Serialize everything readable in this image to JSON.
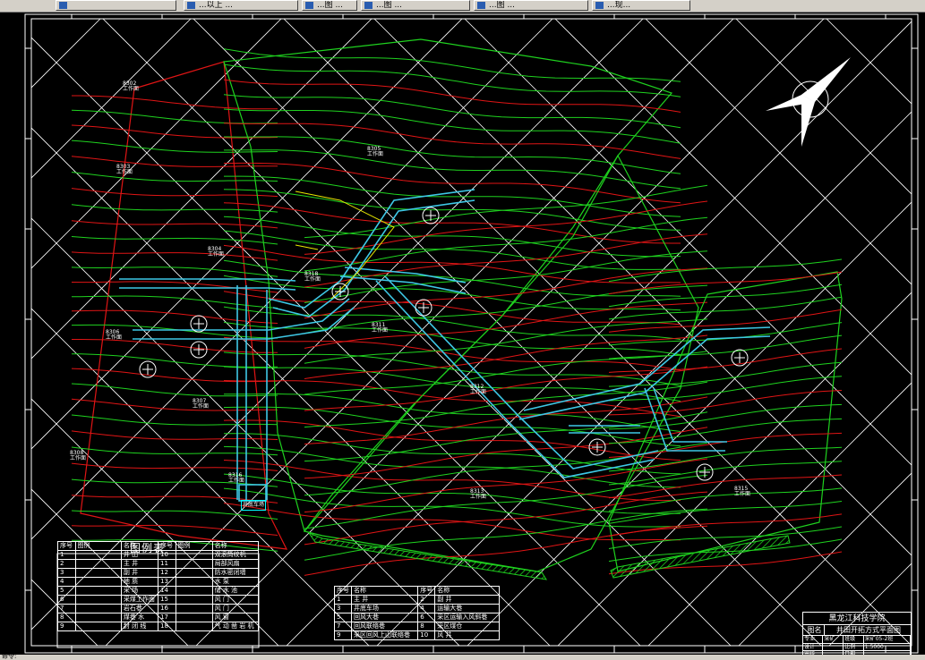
{
  "taskbar": {
    "tabs": [
      {
        "label": ""
      },
      {
        "label": "...以上 ..."
      },
      {
        "label": "...图 ..."
      },
      {
        "label": "...图 ..."
      },
      {
        "label": "...图 ..."
      },
      {
        "label": "...现..."
      }
    ]
  },
  "status": {
    "text": "命令:"
  },
  "legend": {
    "title": "图例表",
    "header": [
      "序号",
      "图例",
      "名称",
      "序号",
      "图例",
      "名称"
    ],
    "rows": [
      [
        "1",
        "",
        "井 田",
        "10",
        "",
        "双滚筒绞机"
      ],
      [
        "2",
        "",
        "主 井",
        "11",
        "",
        "局部风扇"
      ],
      [
        "3",
        "",
        "副 井",
        "12",
        "",
        "防水密闭墙"
      ],
      [
        "4",
        "",
        "地 质",
        "13",
        "",
        "水 泵"
      ],
      [
        "5",
        "",
        "采 场",
        "14",
        "",
        "储 水 池"
      ],
      [
        "6",
        "",
        "采煤工作面",
        "15",
        "",
        "风 门"
      ],
      [
        "7",
        "",
        "岩石巷",
        "16",
        "",
        "风 门"
      ],
      [
        "8",
        "",
        "煤巷 水",
        "17",
        "",
        "风 窗"
      ],
      [
        "9",
        "",
        "封 闭 线",
        "18",
        "",
        "气 动 凿 岩 机"
      ]
    ]
  },
  "notes": {
    "header": [
      "序号",
      "名称",
      "序号",
      "名称"
    ],
    "rows": [
      [
        "1",
        "主 井",
        "2",
        "副 井"
      ],
      [
        "3",
        "井底车场",
        "4",
        "运输大巷"
      ],
      [
        "5",
        "回风大巷",
        "6",
        "采区运输入风斜巷"
      ],
      [
        "7",
        "回风联络巷",
        "8",
        "采区煤仓"
      ],
      [
        "9",
        "采区回风上山联络巷",
        "10",
        "风 井"
      ]
    ]
  },
  "title_block": {
    "school": "黑龙江科技学院",
    "drawing_label": "图名",
    "drawing_name": "井田开拓方式平面图",
    "grid": [
      [
        "专业",
        "采矿",
        "班级",
        "采矿05-2班"
      ],
      [
        "设计",
        "",
        "比例",
        "1:5000"
      ],
      [
        "审核",
        "",
        "日期",
        ""
      ]
    ]
  },
  "plan": {
    "shaft_box_label": "井底车场",
    "block_labels": [
      "8302\n工作面",
      "8303\n工作面",
      "8304\n工作面",
      "8305\n工作面",
      "8306\n工作面",
      "8307\n工作面",
      "8308\n工作面",
      "8311\n工作面",
      "8312\n工作面",
      "8313\n工作面",
      "8315\n工作面",
      "8316\n工作面",
      "8318\n工作面"
    ]
  },
  "colors": {
    "background": "#000000",
    "contour_green": "#1fd21f",
    "contour_red": "#e01515",
    "roadway_cyan": "#3ec8e6",
    "grid_white": "#ffffff",
    "boundary_yellow": "#e8e800"
  },
  "icons": {
    "north_arrow": "north-arrow-icon",
    "shaft": "shaft-icon"
  }
}
